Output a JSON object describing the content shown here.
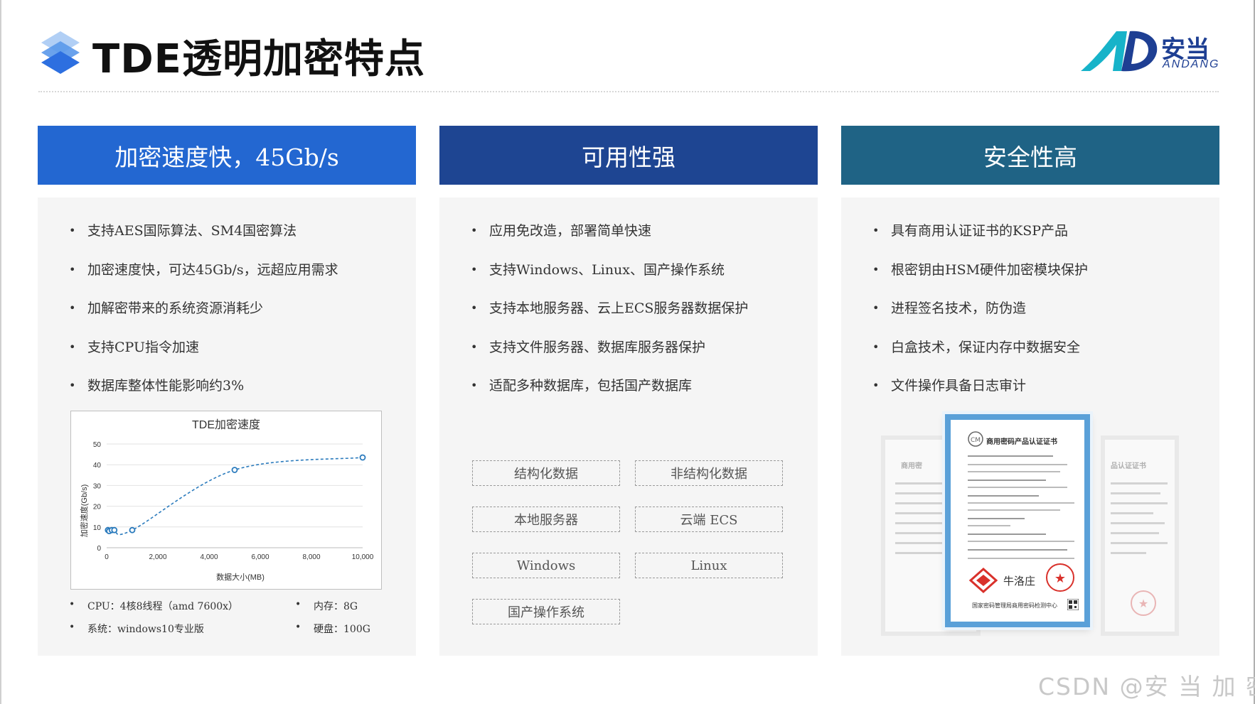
{
  "page": {
    "title": "TDE透明加密特点",
    "brand_cn": "安当",
    "brand_en": "ANDANG",
    "watermark": "CSDN @安 当 加 密"
  },
  "columns": [
    {
      "heading": "加密速度快，45Gb/s",
      "color": "#2367d1",
      "bullets": [
        "支持AES国际算法、SM4国密算法",
        "加密速度快，可达45Gb/s，远超应用需求",
        "加解密带来的系统资源消耗少",
        "支持CPU指令加速",
        "数据库整体性能影响约3%"
      ],
      "specs": {
        "cpu": "CPU：4核8线程（amd 7600x）",
        "memory": "内存：8G",
        "os": "系统：windows10专业版",
        "disk": "硬盘：100G"
      }
    },
    {
      "heading": "可用性强",
      "color": "#1e4592",
      "bullets": [
        "应用免改造，部署简单快速",
        "支持Windows、Linux、国产操作系统",
        "支持本地服务器、云上ECS服务器数据保护",
        "支持文件服务器、数据库服务器保护",
        "适配多种数据库，包括国产数据库"
      ],
      "tags": [
        "结构化数据",
        "非结构化数据",
        "本地服务器",
        "云端 ECS",
        "Windows",
        "Linux",
        "国产操作系统"
      ]
    },
    {
      "heading": "安全性高",
      "color": "#1f6385",
      "bullets": [
        "具有商用认证证书的KSP产品",
        "根密钥由HSM硬件加密模块保护",
        "进程签名技术，防伪造",
        "白盒技术，保证内存中数据安全",
        "文件操作具备日志审计"
      ],
      "certificate": {
        "title": "商用密码产品认证证书",
        "issuer": "国家密码管理局商用密码检测中心",
        "side_title_left": "商用密",
        "side_title_right": "品认证证书"
      }
    }
  ],
  "chart_data": {
    "type": "scatter",
    "title": "TDE加密速度",
    "xlabel": "数据大小(MB)",
    "ylabel": "加密速度(Gb/s)",
    "xlim": [
      0,
      10000
    ],
    "ylim": [
      0,
      50
    ],
    "xticks": [
      0,
      2000,
      4000,
      6000,
      8000,
      10000
    ],
    "xtick_labels": [
      "0",
      "2,000",
      "4,000",
      "6,000",
      "8,000",
      "10,000"
    ],
    "yticks": [
      0,
      10,
      20,
      30,
      40,
      50
    ],
    "grid": true,
    "series": [
      {
        "x": [
          50,
          100,
          200,
          300,
          1000,
          5000,
          10000
        ],
        "y": [
          8.5,
          8,
          8.5,
          8.5,
          8.5,
          37.5,
          43.5
        ],
        "color": "#2b7bbd"
      }
    ]
  }
}
